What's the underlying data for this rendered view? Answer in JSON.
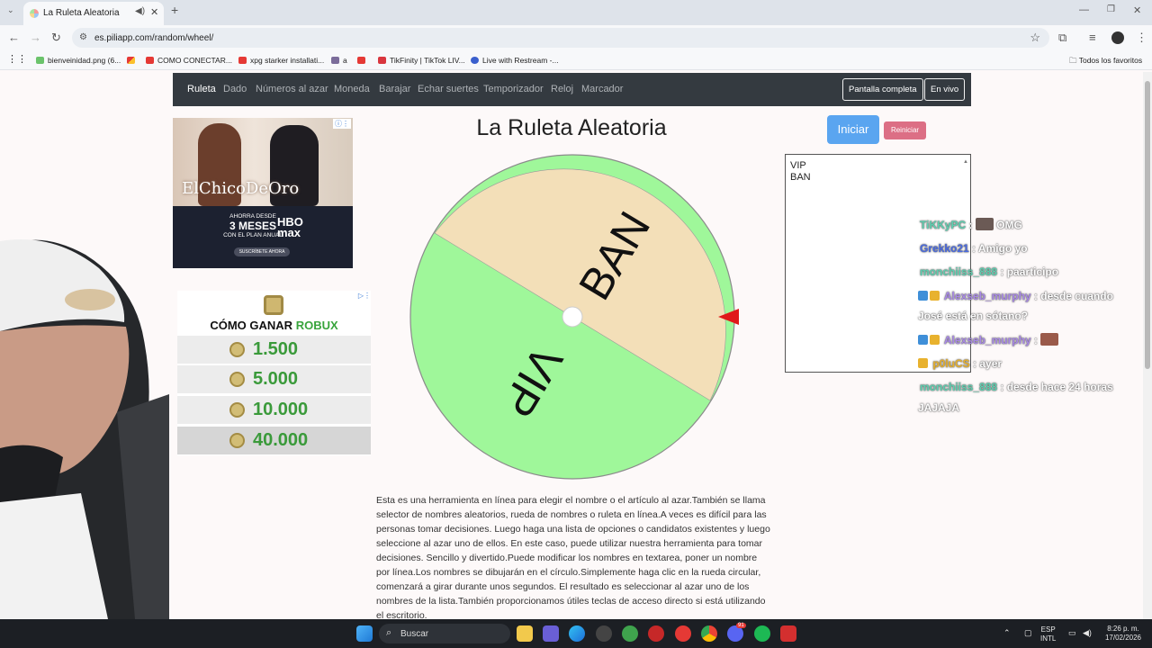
{
  "browser": {
    "tab_title": "La Ruleta Aleatoria",
    "new_tab": "+",
    "url": "es.piliapp.com/random/wheel/",
    "bookmarks": [
      {
        "label": "bienveinidad.png (6...",
        "color": "#6bc36b"
      },
      {
        "label": "",
        "color": "#c2a63b"
      },
      {
        "label": "COMO CONECTAR...",
        "color": "#e53935"
      },
      {
        "label": "xpg starker installati...",
        "color": "#e53935"
      },
      {
        "label": "a",
        "color": "#7b6c9a"
      },
      {
        "label": "",
        "color": "#e53935"
      },
      {
        "label": "TikFinity | TikTok LIV...",
        "color": "#d9363e"
      },
      {
        "label": "Live with Restream -...",
        "color": "#3a5fcd"
      }
    ],
    "all_bookmarks": "Todos los favoritos"
  },
  "site_nav": {
    "links": [
      "Ruleta",
      "Dado",
      "Números al azar",
      "Moneda",
      "Barajar",
      "Echar suertes",
      "Temporizador",
      "Reloj",
      "Marcador"
    ],
    "fullscreen": "Pantalla completa",
    "live": "En vivo"
  },
  "ad1": {
    "brand": "ElChicoDeOro",
    "offer_small": "AHORRA DESDE",
    "offer_big": "3 MESES",
    "offer_plan": "CON EL PLAN ANUAL",
    "service_top": "HBO",
    "service_bottom": "max",
    "cta": "SUSCRÍBETE AHORA"
  },
  "ad2": {
    "title_prefix": "CÓMO GANAR ",
    "title_highlight": "ROBUX",
    "amounts": [
      "1.500",
      "5.000",
      "10.000",
      "40.000"
    ]
  },
  "main": {
    "title": "La Ruleta Aleatoria",
    "start_button": "Iniciar",
    "reset_button": "Reiniciar",
    "names_text": "VIP\nBAN",
    "wheel_segments": [
      {
        "label": "BAN",
        "color": "#f3dfb8"
      },
      {
        "label": "VIP",
        "color": "#9ff79a"
      }
    ],
    "pointer_color": "#e01919",
    "description": "Esta es una herramienta en línea para elegir el nombre o el artículo al azar.También se llama selector de nombres aleatorios, rueda de nombres o ruleta en línea.A veces es difícil para las personas tomar decisiones. Luego haga una lista de opciones o candidatos existentes y luego seleccione al azar uno de ellos. En este caso, puede utilizar nuestra herramienta para tomar decisiones. Sencillo y divertido.Puede modificar los nombres en textarea, poner un nombre por línea.Los nombres se dibujarán en el círculo.Simplemente haga clic en la rueda circular, comenzará a girar durante unos segundos. El resultado es seleccionar al azar uno de los nombres de la lista.También proporcionamos útiles teclas de acceso directo si está utilizando el escritorio."
  },
  "chat": [
    {
      "user": "TiKKyPC",
      "sep": " : ",
      "msg": " OMG",
      "emote": true
    },
    {
      "user": "Grekko21",
      "sep": " : ",
      "msg": "Amigo yo"
    },
    {
      "user": "monchiiss_888",
      "sep": " : ",
      "msg": "paarticipo"
    },
    {
      "user": "Alexseb_murphy",
      "sep": " : ",
      "msg": "desde cuando",
      "msg2": "José está en sótano?",
      "badges": true
    },
    {
      "user": "Alexseb_murphy",
      "sep": " : ",
      "msg": "",
      "emote": true,
      "badges": true
    },
    {
      "user": "p0luCS",
      "sep": " : ",
      "msg": "ayer",
      "badge1": true
    },
    {
      "user": "monchiiss_888",
      "sep": " : ",
      "msg": "desde hace 24 horas",
      "msg2": "JAJAJA"
    }
  ],
  "taskbar": {
    "search": "Buscar",
    "lang_top": "ESP",
    "lang_bottom": "INTL",
    "time": "8:26 p. m.",
    "date": "17/02/2026",
    "discord_badge": "91"
  }
}
